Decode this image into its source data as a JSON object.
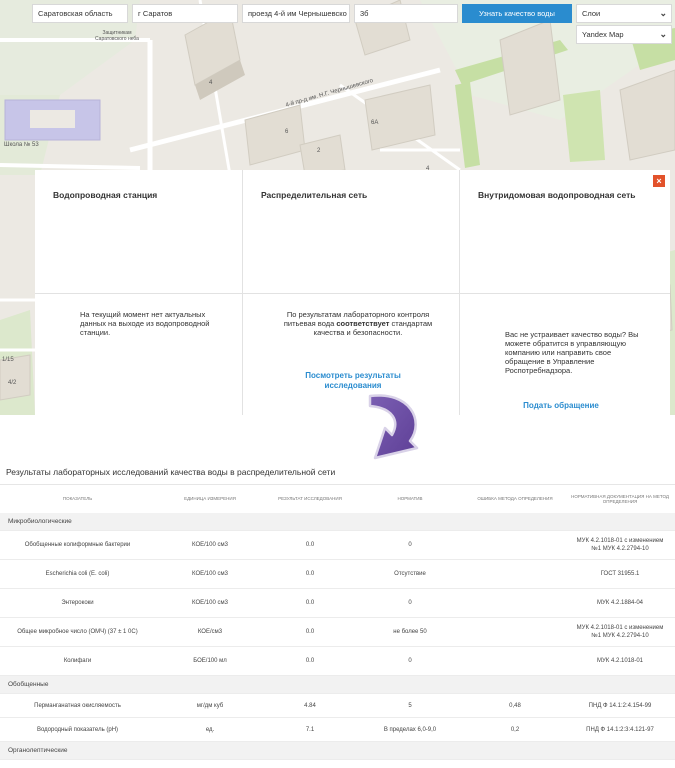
{
  "search": {
    "region": "Саратовская область",
    "city": "г Саратов",
    "street": "проезд 4-й им Чернышевско",
    "house": "3б",
    "button_label": "Узнать качество воды",
    "layers_label": "Слои",
    "map_type": "Yandex Map"
  },
  "map": {
    "labels": {
      "school": "Школа № 53",
      "museum": "Защитникам Саратовского неба",
      "street": "4-й пр-д им. Н.Г. Чернышевского",
      "b1": "4",
      "b2": "6",
      "b3": "2",
      "b4": "6А",
      "b5": "4/2",
      "b6": "1/15",
      "b7": "4"
    }
  },
  "panel": {
    "columns": [
      {
        "title": "Водопроводная станция",
        "text": "На текущий момент нет актуальных данных на выходе из водопроводной станции."
      },
      {
        "title": "Распределительная сеть",
        "text_before": "По результатам лабораторного контроля питьевая вода ",
        "text_bold": "соответствует",
        "text_after": " стандартам качества и безопасности.",
        "link": "Посмотреть результаты исследования"
      },
      {
        "title": "Внутридомовая водопроводная сеть",
        "text": "Вас не устраивает качество воды? Вы можете обратится в управляющую компанию или направить свое обращение в Управление Роспотребнадзора.",
        "link": "Подать обращение"
      }
    ],
    "close_icon": "×"
  },
  "results": {
    "title": "Результаты лабораторных исследований качества воды в распределительной сети",
    "headers": [
      "Показатель",
      "Единица измерения",
      "Результат исследования",
      "Норматив",
      "Ошибка метода определения",
      "Нормативная документация на метод определения"
    ],
    "groups": [
      {
        "name": "Микробиологические",
        "rows": [
          [
            "Обобщенные колиформные бактерии",
            "КОЕ/100 см3",
            "0.0",
            "0",
            "",
            "МУК 4.2.1018-01 с изменением №1 МУК 4.2.2794-10"
          ],
          [
            "Escherichia coli (E. coli)",
            "КОЕ/100 см3",
            "0.0",
            "Отсутствие",
            "",
            "ГОСТ 31955.1"
          ],
          [
            "Энтерококи",
            "КОЕ/100 см3",
            "0.0",
            "0",
            "",
            "МУК 4.2.1884-04"
          ],
          [
            "Общее микробное число (ОМЧ) (37 ± 1 0С)",
            "КОЕ/см3",
            "0.0",
            "не более 50",
            "",
            "МУК 4.2.1018-01 с изменением №1 МУК 4.2.2794-10"
          ],
          [
            "Колифаги",
            "БОЕ/100 мл",
            "0.0",
            "0",
            "",
            "МУК 4.2.1018-01"
          ]
        ]
      },
      {
        "name": "Обобщенные",
        "rows": [
          [
            "Перманганатная окисляемость",
            "мг/дм куб",
            "4.84",
            "5",
            "0,48",
            "ПНД Ф 14.1:2:4.154-99"
          ],
          [
            "Водородный показатель (рН)",
            "ед.",
            "7.1",
            "В пределах 6,0-9,0",
            "0,2",
            "ПНД Ф 14.1:2:3:4.121-97"
          ]
        ]
      },
      {
        "name": "Органолептические",
        "rows": []
      }
    ]
  }
}
